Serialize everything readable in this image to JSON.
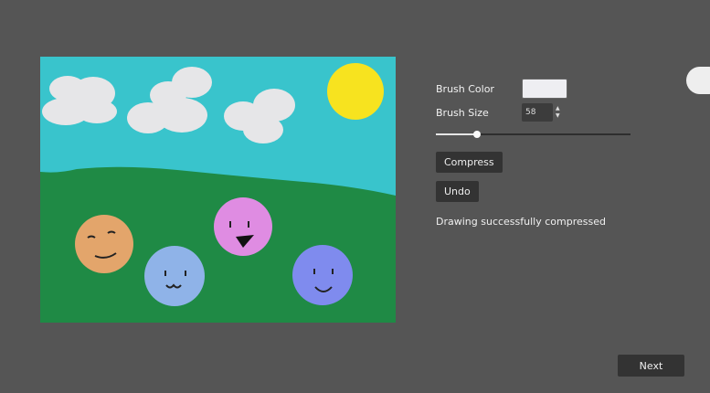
{
  "canvas": {
    "colors": {
      "sky": "#39c4cc",
      "grass": "#1f8a45",
      "sun": "#f7e31f",
      "cloud": "#e6e6e8",
      "face_orange": "#e3a56b",
      "face_blue": "#8fb3e8",
      "face_pink": "#df8ce2",
      "face_periwinkle": "#7f8bee"
    }
  },
  "controls": {
    "brush_color_label": "Brush Color",
    "brush_color_value": "#eeeef2",
    "brush_size_label": "Brush Size",
    "brush_size_value": "58",
    "size_slider_fraction": 0.21,
    "compress_label": "Compress",
    "undo_label": "Undo",
    "status": "Drawing successfully compressed"
  },
  "footer": {
    "next_label": "Next"
  }
}
